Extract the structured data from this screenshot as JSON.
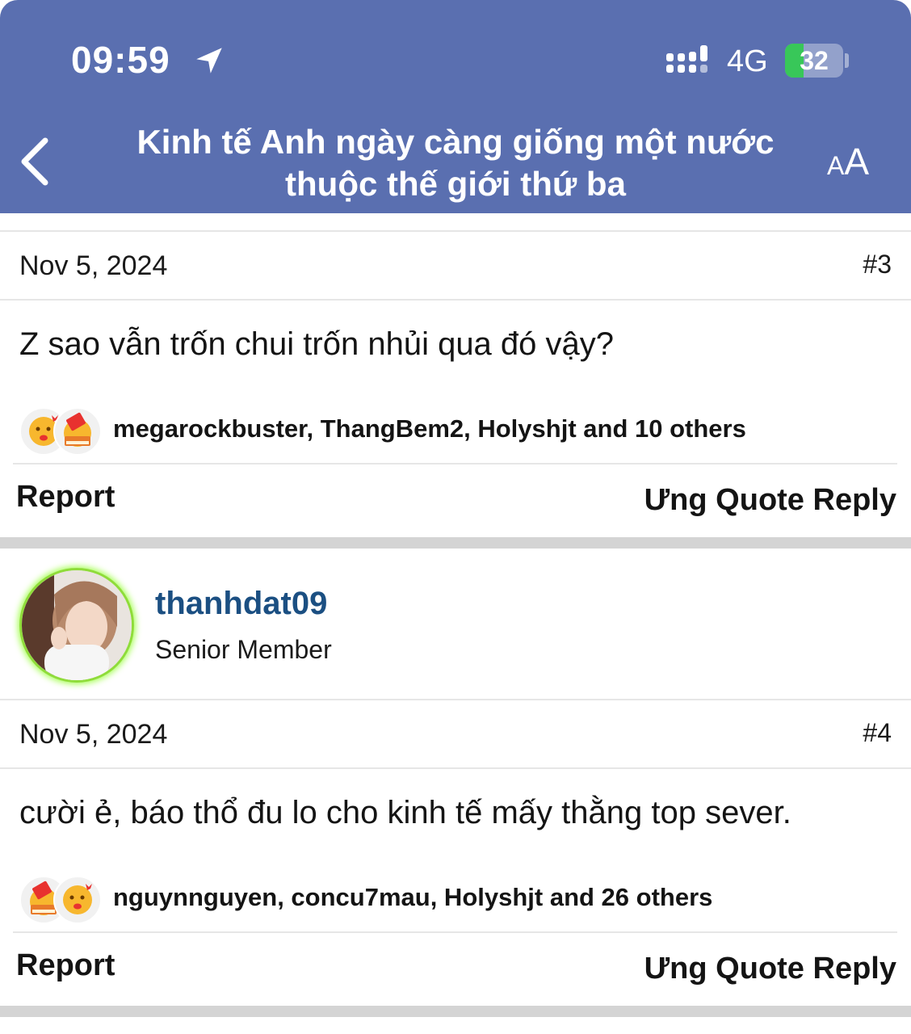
{
  "status_bar": {
    "time": "09:59",
    "network": "4G",
    "battery": "32",
    "battery_level_pct": 32,
    "battery_color": "#38c759",
    "icons": [
      "location-arrow-icon",
      "signal-bars-icon",
      "battery-charging-icon"
    ]
  },
  "header": {
    "title": "Kinh tế Anh ngày càng giống một nước thuộc thế giới thứ ba",
    "back_icon": "chevron-left-icon",
    "font_size_label_small": "A",
    "font_size_label_large": "A",
    "background_color": "#5a6fb0"
  },
  "posts": [
    {
      "date": "Nov 5, 2024",
      "number": "#3",
      "content": "Z sao vẫn trốn chui trốn nhủi qua đó vậy?",
      "reaction_icons": [
        "kiss-emoji-icon",
        "book-emoji-icon"
      ],
      "likers": "megarockbuster, ThangBem2, Holyshjt and 10 others",
      "report_label": "Report",
      "ung_label": "Ưng",
      "quote_label": "Quote",
      "reply_label": "Reply"
    },
    {
      "author": {
        "name": "thanhdat09",
        "title": "Senior Member",
        "name_color": "#1b4f82"
      },
      "date": "Nov 5, 2024",
      "number": "#4",
      "content": "cười ẻ, báo thổ đu lo cho kinh tế mấy thằng top sever.",
      "reaction_icons": [
        "book-emoji-icon",
        "kiss-emoji-icon"
      ],
      "likers": "nguynnguyen, concu7mau, Holyshjt and 26 others",
      "report_label": "Report",
      "ung_label": "Ưng",
      "quote_label": "Quote",
      "reply_label": "Reply"
    }
  ]
}
